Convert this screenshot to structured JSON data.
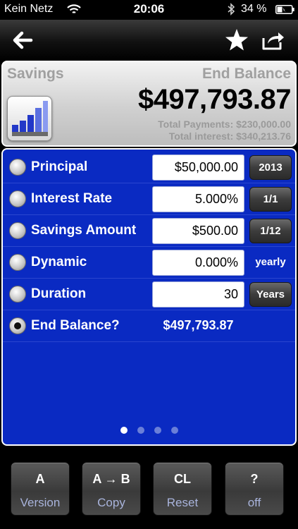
{
  "status_bar": {
    "carrier": "Kein Netz",
    "time": "20:06",
    "battery_percent": "34 %"
  },
  "nav": {
    "icons": [
      "back-arrow-icon",
      "star-icon",
      "share-icon"
    ]
  },
  "result": {
    "mode": "Savings",
    "target": "End Balance",
    "value": "$497,793.87",
    "total_payments": "Total Payments: $230,000.00",
    "total_interest": "Total interest: $340,213.76"
  },
  "rows": [
    {
      "label": "Principal",
      "value": "$50,000.00",
      "side": "2013",
      "selected": false
    },
    {
      "label": "Interest Rate",
      "value": "5.000%",
      "side": "1/1",
      "selected": false
    },
    {
      "label": "Savings Amount",
      "value": "$500.00",
      "side": "1/12",
      "selected": false
    },
    {
      "label": "Dynamic",
      "value": "0.000%",
      "side": "yearly",
      "selected": false
    },
    {
      "label": "Duration",
      "value": "30",
      "side": "Years",
      "selected": false
    },
    {
      "label": "End Balance?",
      "value": "$497,793.87",
      "side": "",
      "selected": true
    }
  ],
  "pager": {
    "pages": 4,
    "current": 1
  },
  "keys": [
    {
      "main": "A",
      "sub": "Version"
    },
    {
      "main": "A → B",
      "sub": "Copy"
    },
    {
      "main": "CL",
      "sub": "Reset"
    },
    {
      "main": "?",
      "sub": "off"
    }
  ],
  "colors": {
    "panel_blue": "#0a2ac2",
    "key_sub_text": "#a9b4dc",
    "chart_icon_bar": "#2238c8"
  }
}
